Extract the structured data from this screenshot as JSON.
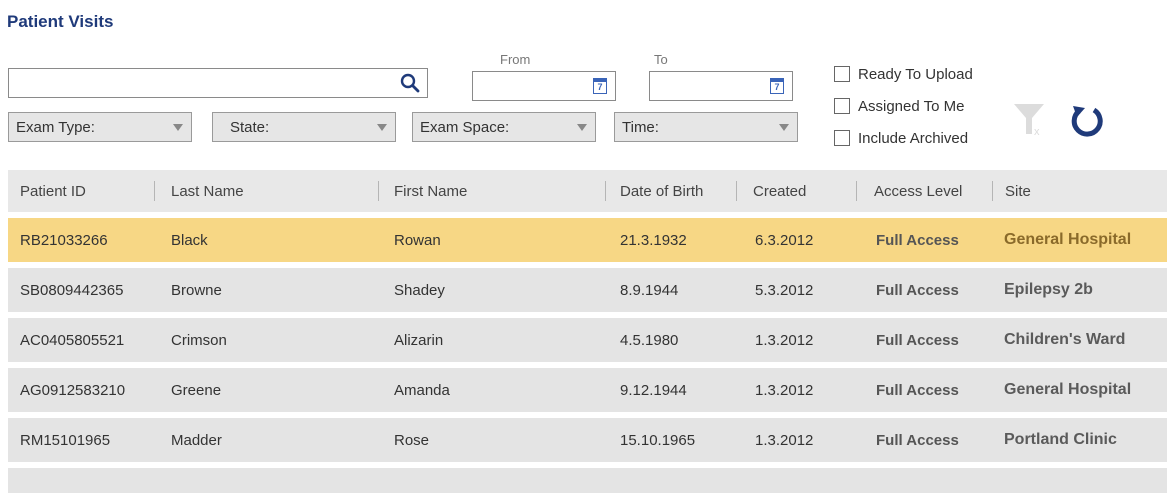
{
  "page": {
    "title": "Patient Visits"
  },
  "search": {
    "value": "",
    "placeholder": ""
  },
  "date_range": {
    "from_label": "From",
    "to_label": "To",
    "from_value": "",
    "to_value": "",
    "calendar_glyph": "7"
  },
  "checkboxes": [
    {
      "label": "Ready To Upload",
      "checked": false
    },
    {
      "label": "Assigned To Me",
      "checked": false
    },
    {
      "label": "Include Archived",
      "checked": false
    }
  ],
  "filters": [
    {
      "label": "Exam Type:",
      "value": ""
    },
    {
      "label": "State:",
      "value": ""
    },
    {
      "label": "Exam Space:",
      "value": ""
    },
    {
      "label": "Time:",
      "value": ""
    }
  ],
  "icons": {
    "search": "search-icon",
    "calendar": "calendar-icon",
    "clear_filter": "clear-filter-icon",
    "refresh": "refresh-icon"
  },
  "colors": {
    "title": "#1f3a7a",
    "selected_row": "#f7d785",
    "row": "#e4e4e4",
    "header": "#e8e8e8",
    "refresh_icon": "#1f3a7a"
  },
  "table": {
    "columns": [
      "Patient ID",
      "Last Name",
      "First Name",
      "Date of Birth",
      "Created",
      "Access Level",
      "Site"
    ],
    "rows": [
      {
        "patient_id": "RB21033266",
        "last_name": "Black",
        "first_name": "Rowan",
        "dob": "21.3.1932",
        "created": "6.3.2012",
        "access": "Full Access",
        "site": "General Hospital",
        "selected": true
      },
      {
        "patient_id": "SB0809442365",
        "last_name": "Browne",
        "first_name": "Shadey",
        "dob": "8.9.1944",
        "created": "5.3.2012",
        "access": "Full Access",
        "site": "Epilepsy 2b",
        "selected": false
      },
      {
        "patient_id": "AC0405805521",
        "last_name": "Crimson",
        "first_name": "Alizarin",
        "dob": "4.5.1980",
        "created": "1.3.2012",
        "access": "Full Access",
        "site": "Children's Ward",
        "selected": false
      },
      {
        "patient_id": "AG0912583210",
        "last_name": "Greene",
        "first_name": "Amanda",
        "dob": "9.12.1944",
        "created": "1.3.2012",
        "access": "Full Access",
        "site": "General Hospital",
        "selected": false
      },
      {
        "patient_id": "RM15101965",
        "last_name": "Madder",
        "first_name": "Rose",
        "dob": "15.10.1965",
        "created": "1.3.2012",
        "access": "Full Access",
        "site": "Portland Clinic",
        "selected": false
      }
    ]
  }
}
